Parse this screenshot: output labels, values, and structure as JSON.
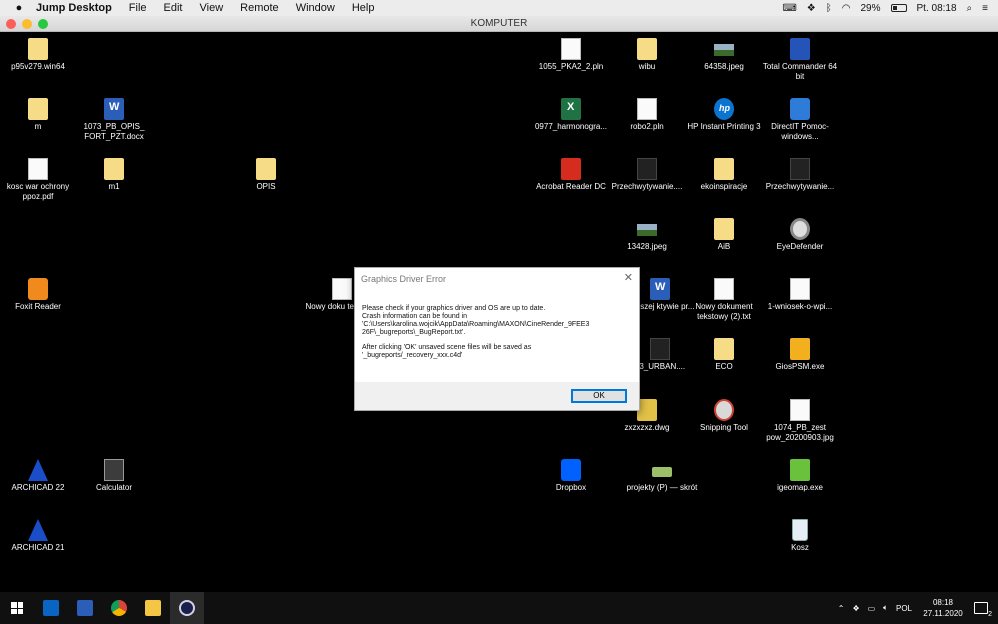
{
  "menubar": {
    "apple_icon": "apple-icon",
    "app_name": "Jump Desktop",
    "items": [
      "File",
      "Edit",
      "View",
      "Remote",
      "Window",
      "Help"
    ],
    "battery_pct": "29%",
    "datetime": "Pt. 08:18"
  },
  "window": {
    "title": "KOMPUTER"
  },
  "desktop_icons": [
    {
      "label": "p95v279.win64",
      "icon": "folder"
    },
    {
      "label": "m",
      "icon": "folder"
    },
    {
      "label": "1073_PB_OPIS_ FORT_PZT.docx",
      "icon": "word"
    },
    {
      "label": "kosc war ochrony ppoz.pdf",
      "icon": "doc"
    },
    {
      "label": "m1",
      "icon": "folder"
    },
    {
      "label": "OPIS",
      "icon": "folder"
    },
    {
      "label": "Foxit Reader",
      "icon": "foxit"
    },
    {
      "label": "Nowy doku tekstowy",
      "icon": "doc"
    },
    {
      "label": "ARCHICAD 22",
      "icon": "archicad"
    },
    {
      "label": "Calculator",
      "icon": "calculator"
    },
    {
      "label": "ARCHICAD 21",
      "icon": "archicad"
    },
    {
      "label": "1055_PKA2_2.pln",
      "icon": "doc"
    },
    {
      "label": "wibu",
      "icon": "folder"
    },
    {
      "label": "64358.jpeg",
      "icon": "image"
    },
    {
      "label": "Total Commander 64 bit",
      "icon": "floppy"
    },
    {
      "label": "0977_harmonogra...",
      "icon": "excel"
    },
    {
      "label": "robo2.pln",
      "icon": "doc"
    },
    {
      "label": "HP Instant Printing 3",
      "icon": "hp"
    },
    {
      "label": "DirectIT Pomoc-windows...",
      "icon": "blue-app"
    },
    {
      "label": "Acrobat Reader DC",
      "icon": "pdf"
    },
    {
      "label": "Przechwytywanie....",
      "icon": "dark-file"
    },
    {
      "label": "ekoinspiracje",
      "icon": "folder"
    },
    {
      "label": "Przechwytywanie...",
      "icon": "dark-file"
    },
    {
      "label": "13428.jpeg",
      "icon": "image"
    },
    {
      "label": "AiB",
      "icon": "folder"
    },
    {
      "label": "EyeDefender",
      "icon": "eye"
    },
    {
      "label": "dłuższej ktywie pr...",
      "icon": "word"
    },
    {
      "label": "Nowy dokument tekstowy (2).txt",
      "icon": "doc"
    },
    {
      "label": "1-wniosek-o-wpi...",
      "icon": "doc"
    },
    {
      "label": "03_URBAN....",
      "icon": "dark-file"
    },
    {
      "label": "ECO",
      "icon": "folder"
    },
    {
      "label": "GiosPSM.exe",
      "icon": "gios"
    },
    {
      "label": "zxzxzxz.dwg",
      "icon": "dwg"
    },
    {
      "label": "Snipping Tool",
      "icon": "snipping"
    },
    {
      "label": "1074_PB_zest pow_20200903.jpg",
      "icon": "doc"
    },
    {
      "label": "Dropbox",
      "icon": "dropbox"
    },
    {
      "label": "projekty (P) — skrót",
      "icon": "network"
    },
    {
      "label": "igeomap.exe",
      "icon": "igeo"
    },
    {
      "label": "Kosz",
      "icon": "recycle-bin"
    }
  ],
  "dialog": {
    "title": "Graphics Driver Error",
    "close_icon": "close-icon",
    "paragraph1": "Please check if your graphics driver and OS are up to date.\nCrash information can be found in\n'C:\\Users\\karolina.wojcik\\AppData\\Roaming\\MAXON\\CineRender_9FEE3\n26F\\_bugreports\\_BugReport.txt'.",
    "paragraph2": "After clicking 'OK' unsaved scene files will be saved as\n'_bugreports/_recovery_xxx.c4d'",
    "ok_label": "OK"
  },
  "taskbar": {
    "apps": [
      "start",
      "outlook",
      "word",
      "chrome",
      "file-explorer",
      "cinema4d"
    ],
    "language": "POL",
    "time": "08:18",
    "date": "27.11.2020",
    "notification_count": "2"
  },
  "colors": {
    "desktop_bg": "#000000",
    "accent": "#0078d7",
    "taskbar_bg": "#101010"
  }
}
